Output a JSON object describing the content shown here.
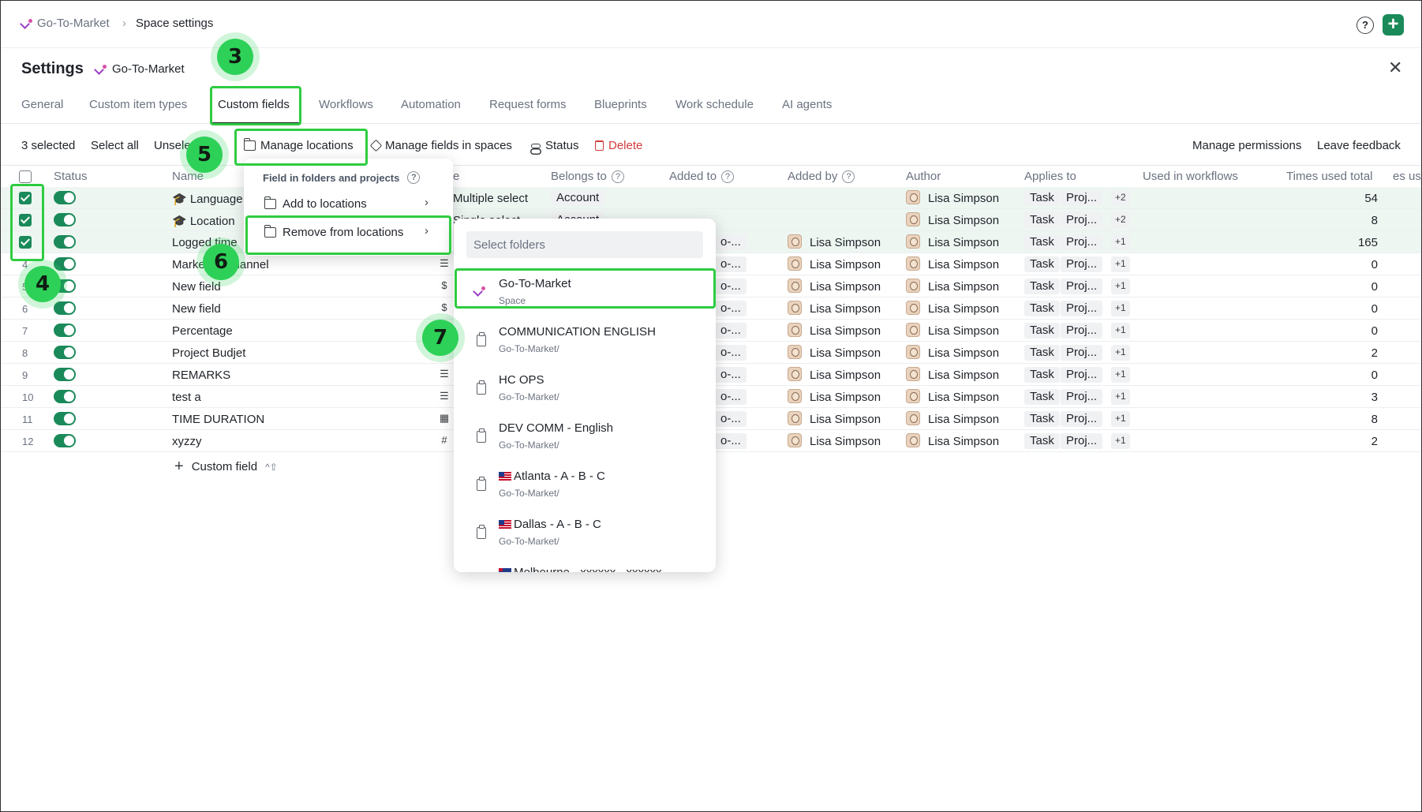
{
  "breadcrumb": {
    "space": "Go-To-Market",
    "separator": "›",
    "current": "Space settings"
  },
  "header": {
    "help_icon": "?",
    "add_icon": "+"
  },
  "settings": {
    "title": "Settings",
    "space": "Go-To-Market",
    "close_icon": "✕"
  },
  "tabs": [
    {
      "label": "General"
    },
    {
      "label": "Custom item types"
    },
    {
      "label": "Custom fields",
      "active": true
    },
    {
      "label": "Workflows"
    },
    {
      "label": "Automation"
    },
    {
      "label": "Request forms"
    },
    {
      "label": "Blueprints"
    },
    {
      "label": "Work schedule"
    },
    {
      "label": "AI agents"
    }
  ],
  "actionbar": {
    "selected_count": "3 selected",
    "select_all": "Select all",
    "unselect": "Unsele",
    "manage_locations": "Manage locations",
    "manage_fields": "Manage fields in spaces",
    "status": "Status",
    "delete": "Delete",
    "manage_permissions": "Manage permissions",
    "leave_feedback": "Leave feedback"
  },
  "columns": {
    "status": "Status",
    "name": "Name",
    "type": "e",
    "belongs_to": "Belongs to",
    "added_to": "Added to",
    "added_by": "Added by",
    "author": "Author",
    "applies_to": "Applies to",
    "used_in_workflows": "Used in workflows",
    "times_used_total": "Times used total",
    "extra": "es use"
  },
  "rows": [
    {
      "num": "",
      "name": "🎓 Language",
      "type_text": "Multiple select",
      "belongs": "Account",
      "added_to": "",
      "added_by": "",
      "author": "Lisa Simpson",
      "applies": "Task",
      "proj": "Proj...",
      "more": "+2",
      "times": "54",
      "selected": true
    },
    {
      "num": "",
      "name": "🎓 Location",
      "type_text": "Single select",
      "belongs": "Account",
      "added_to": "",
      "added_by": "",
      "author": "Lisa Simpson",
      "applies": "Task",
      "proj": "Proj...",
      "more": "+2",
      "times": "8",
      "selected": true
    },
    {
      "num": "",
      "name": "Logged time",
      "type_icon": "",
      "belongs": "",
      "added_to": "o-...",
      "added_by": "Lisa Simpson",
      "author": "Lisa Simpson",
      "applies": "Task",
      "proj": "Proj...",
      "more": "+1",
      "times": "165",
      "selected": true
    },
    {
      "num": "4",
      "name": "Marketing channel",
      "type_icon": "☰",
      "belongs": "",
      "added_to": "o-...",
      "added_by": "Lisa Simpson",
      "author": "Lisa Simpson",
      "applies": "Task",
      "proj": "Proj...",
      "more": "+1",
      "times": "0"
    },
    {
      "num": "5",
      "name": "New field",
      "type_icon": "$",
      "belongs": "",
      "added_to": "o-...",
      "added_by": "Lisa Simpson",
      "author": "Lisa Simpson",
      "applies": "Task",
      "proj": "Proj...",
      "more": "+1",
      "times": "0"
    },
    {
      "num": "6",
      "name": "New field",
      "type_icon": "$",
      "belongs": "",
      "added_to": "o-...",
      "added_by": "Lisa Simpson",
      "author": "Lisa Simpson",
      "applies": "Task",
      "proj": "Proj...",
      "more": "+1",
      "times": "0"
    },
    {
      "num": "7",
      "name": "Percentage",
      "type_icon": "",
      "belongs": "",
      "added_to": "o-...",
      "added_by": "Lisa Simpson",
      "author": "Lisa Simpson",
      "applies": "Task",
      "proj": "Proj...",
      "more": "+1",
      "times": "0"
    },
    {
      "num": "8",
      "name": "Project Budjet",
      "type_icon": "",
      "belongs": "",
      "added_to": "o-...",
      "added_by": "Lisa Simpson",
      "author": "Lisa Simpson",
      "applies": "Task",
      "proj": "Proj...",
      "more": "+1",
      "times": "2"
    },
    {
      "num": "9",
      "name": "REMARKS",
      "type_icon": "☰",
      "belongs": "",
      "added_to": "o-...",
      "added_by": "Lisa Simpson",
      "author": "Lisa Simpson",
      "applies": "Task",
      "proj": "Proj...",
      "more": "+1",
      "times": "0"
    },
    {
      "num": "10",
      "name": "test a",
      "type_icon": "☰",
      "belongs": "",
      "added_to": "o-...",
      "added_by": "Lisa Simpson",
      "author": "Lisa Simpson",
      "applies": "Task",
      "proj": "Proj...",
      "more": "+1",
      "times": "3"
    },
    {
      "num": "11",
      "name": "TIME DURATION",
      "type_icon": "▦",
      "belongs": "",
      "added_to": "o-...",
      "added_by": "Lisa Simpson",
      "author": "Lisa Simpson",
      "applies": "Task",
      "proj": "Proj...",
      "more": "+1",
      "times": "8"
    },
    {
      "num": "12",
      "name": "xyzzy",
      "type_icon": "#",
      "belongs": "",
      "added_to": "o-...",
      "added_by": "Lisa Simpson",
      "author": "Lisa Simpson",
      "applies": "Task",
      "proj": "Proj...",
      "more": "+1",
      "times": "2"
    }
  ],
  "add_field": {
    "label": "Custom field",
    "shortcut": "^⇧"
  },
  "locations_menu": {
    "title": "Field in folders and projects",
    "add": "Add to locations",
    "remove": "Remove from locations"
  },
  "folders": {
    "search_placeholder": "Select folders",
    "items": [
      {
        "name": "Go-To-Market",
        "sub": "Space",
        "kind": "space"
      },
      {
        "name": "COMMUNICATION ENGLISH",
        "sub": "Go-To-Market/",
        "kind": "folder"
      },
      {
        "name": "HC OPS",
        "sub": "Go-To-Market/",
        "kind": "folder"
      },
      {
        "name": "DEV COMM - English",
        "sub": "Go-To-Market/",
        "kind": "folder"
      },
      {
        "name": "Atlanta - A - B - C",
        "sub": "Go-To-Market/",
        "kind": "folder",
        "flag": "us"
      },
      {
        "name": "Dallas - A - B - C",
        "sub": "Go-To-Market/",
        "kind": "folder",
        "flag": "us"
      },
      {
        "name": "Melbourne - xxxxxx - xxxxxx - ...",
        "sub": "",
        "kind": "folder",
        "flag": "au"
      }
    ]
  },
  "annotations": [
    "3",
    "4",
    "5",
    "6",
    "7"
  ],
  "colors": {
    "accent": "#1a8a5a",
    "highlight": "#2ecc40",
    "delete": "#d33b3b"
  }
}
